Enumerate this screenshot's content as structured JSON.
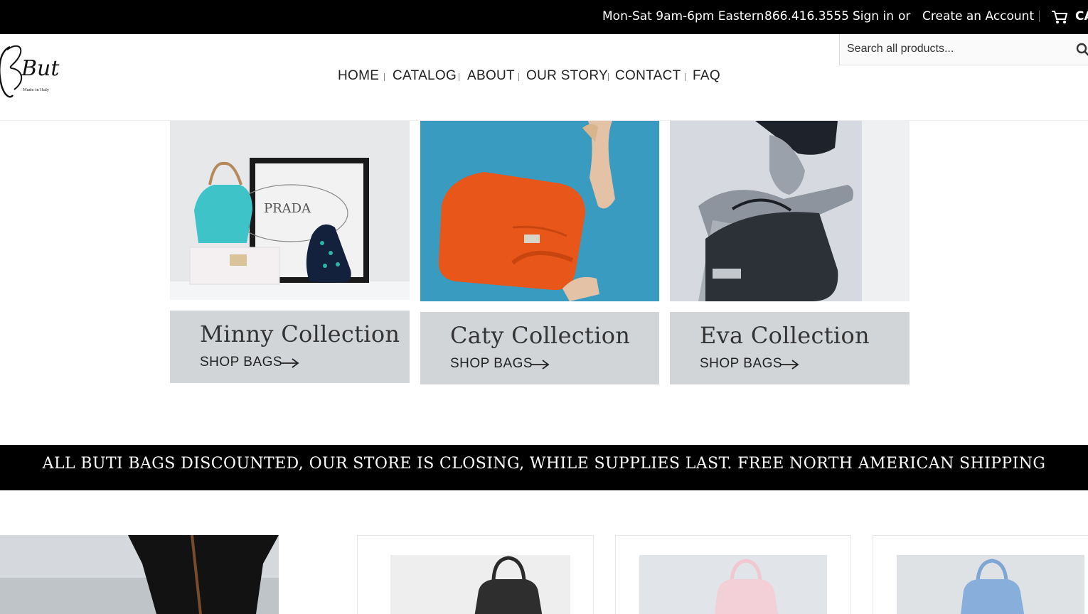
{
  "topbar": {
    "hours": "Mon-Sat 9am-6pm Eastern",
    "phone": "866.416.3555",
    "sign_in": "Sign in",
    "or": "or",
    "create_account": "Create an Account",
    "cart": "CART"
  },
  "brand": {
    "logo_text": "Buti",
    "logo_tagline": "Made in Italy"
  },
  "nav": {
    "items": [
      "HOME",
      "CATALOG",
      "ABOUT",
      "OUR STORY",
      "CONTACT",
      "FAQ"
    ]
  },
  "search": {
    "placeholder": "Search all products..."
  },
  "collections": [
    {
      "title": "Minny Collection",
      "link": "SHOP BAGS"
    },
    {
      "title": "Caty Collection",
      "link": "SHOP BAGS"
    },
    {
      "title": "Eva Collection",
      "link": "SHOP BAGS"
    }
  ],
  "banner": {
    "text": "ALL BUTI BAGS DISCOUNTED, OUR STORE IS CLOSING, WHILE SUPPLIES LAST. FREE NORTH AMERICAN SHIPPING"
  },
  "colors": {
    "topbar_bg": "#000000",
    "card_bg": "#d2d5d8",
    "banner_bg": "#000000"
  },
  "icons": [
    "cart-icon",
    "search-icon",
    "arrow-right-icon"
  ]
}
